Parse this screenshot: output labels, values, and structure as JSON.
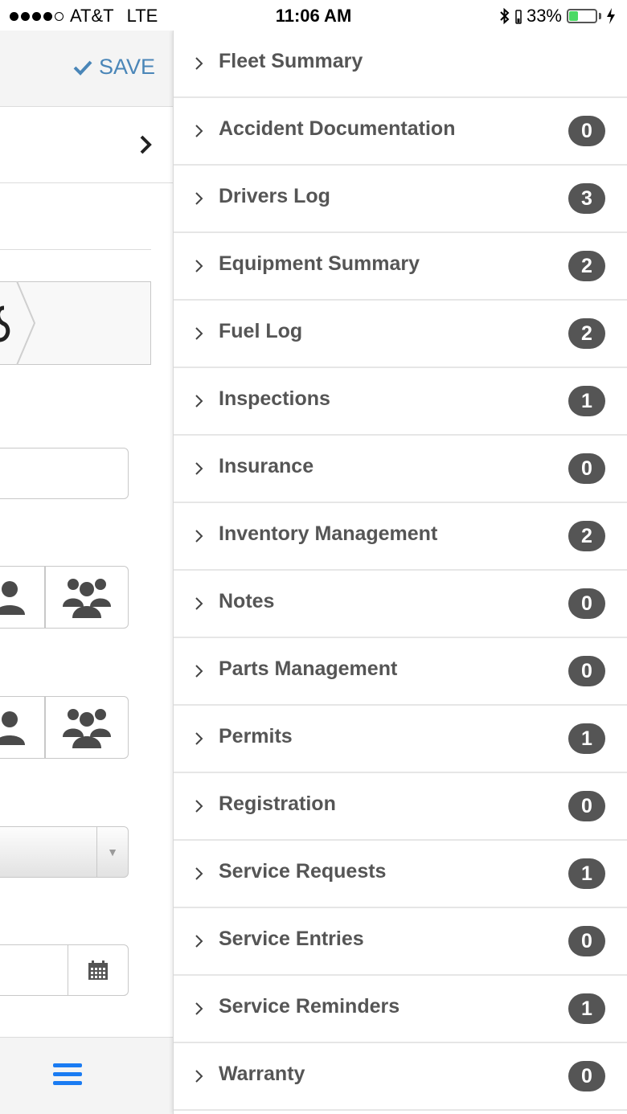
{
  "status_bar": {
    "carrier": "AT&T",
    "network": "LTE",
    "time": "11:06 AM",
    "battery": "33%",
    "battery_level": 0.33,
    "signal_bars": 4,
    "signal_total": 5
  },
  "header": {
    "save_label": "SAVE"
  },
  "colors": {
    "accent": "#4a86b8",
    "menu_button": "#1a7bf2",
    "badge": "#555555",
    "text": "#555555"
  },
  "menu": {
    "items": [
      {
        "label": "Fleet Summary",
        "count": null
      },
      {
        "label": "Accident Documentation",
        "count": "0"
      },
      {
        "label": "Drivers Log",
        "count": "3"
      },
      {
        "label": "Equipment Summary",
        "count": "2"
      },
      {
        "label": "Fuel Log",
        "count": "2"
      },
      {
        "label": "Inspections",
        "count": "1"
      },
      {
        "label": "Insurance",
        "count": "0"
      },
      {
        "label": "Inventory Management",
        "count": "2"
      },
      {
        "label": "Notes",
        "count": "0"
      },
      {
        "label": "Parts Management",
        "count": "0"
      },
      {
        "label": "Permits",
        "count": "1"
      },
      {
        "label": "Registration",
        "count": "0"
      },
      {
        "label": "Service Requests",
        "count": "1"
      },
      {
        "label": "Service Entries",
        "count": "0"
      },
      {
        "label": "Service Reminders",
        "count": "1"
      },
      {
        "label": "Warranty",
        "count": "0"
      }
    ]
  },
  "icons": {
    "save": "checkmark-icon",
    "nav": "chevron-right-icon",
    "person": "user-icon",
    "group": "users-icon",
    "select": "caret-down-icon",
    "date": "calendar-icon",
    "menu": "hamburger-icon",
    "row": "chevron-right-icon"
  }
}
